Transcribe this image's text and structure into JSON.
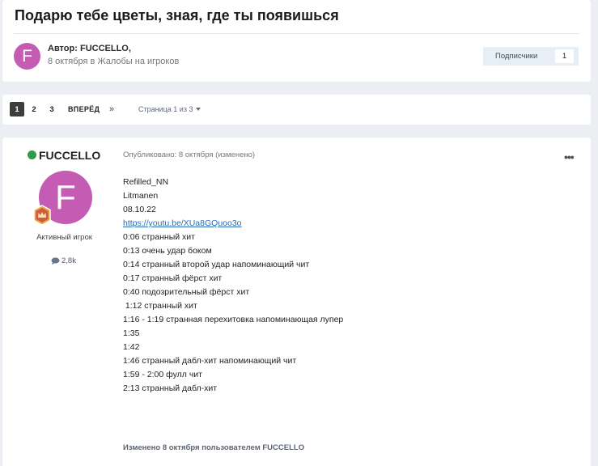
{
  "topic": {
    "title": "Подарю тебе цветы, зная, где ты появишься",
    "avatar_letter": "F",
    "author_prefix": "Автор: ",
    "author_name": "FUCCELLO",
    "author_suffix": ",",
    "date": "8 октября",
    "date_in": " в ",
    "forum": "Жалобы на игроков",
    "followers_label": "Подписчики",
    "followers_count": "1"
  },
  "pagination": {
    "pages": [
      "1",
      "2",
      "3"
    ],
    "current": "1",
    "next_label": "ВПЕРЁД",
    "last_label": "»",
    "page_of": "Страница 1 из 3"
  },
  "post": {
    "author": "FUCCELLO",
    "avatar_letter": "F",
    "group": "Активный игрок",
    "post_count": "2,8k",
    "posted_meta": "Опубликовано: 8 октября (изменено)",
    "menu_icon": "•••",
    "lines": [
      "Refilled_NN",
      "Litmanen",
      "08.10.22",
      "https://youtu.be/XUa8GQuoo3o",
      "0:06 странный хит",
      "0:13 очень удар боком",
      "0:14 странный второй удар напоминающий чит",
      "0:17 странный фёрст хит",
      "0:40 подозрительный фёрст хит",
      " 1:12 странный хит",
      "1:16 - 1:19 странная перехитовка напоминающая лупер",
      "1:35",
      "1:42",
      "1:46 странный дабл-хит напоминающий чит",
      "1:59 - 2:00 фулл чит",
      "2:13 странный дабл-хит"
    ],
    "edit_note": "Изменено 8 октября пользователем FUCCELLO"
  },
  "colors": {
    "avatar": "#c55cb3",
    "online": "#2f9a4a",
    "link": "#2a6bb5",
    "active_page": "#3d3d3d"
  }
}
